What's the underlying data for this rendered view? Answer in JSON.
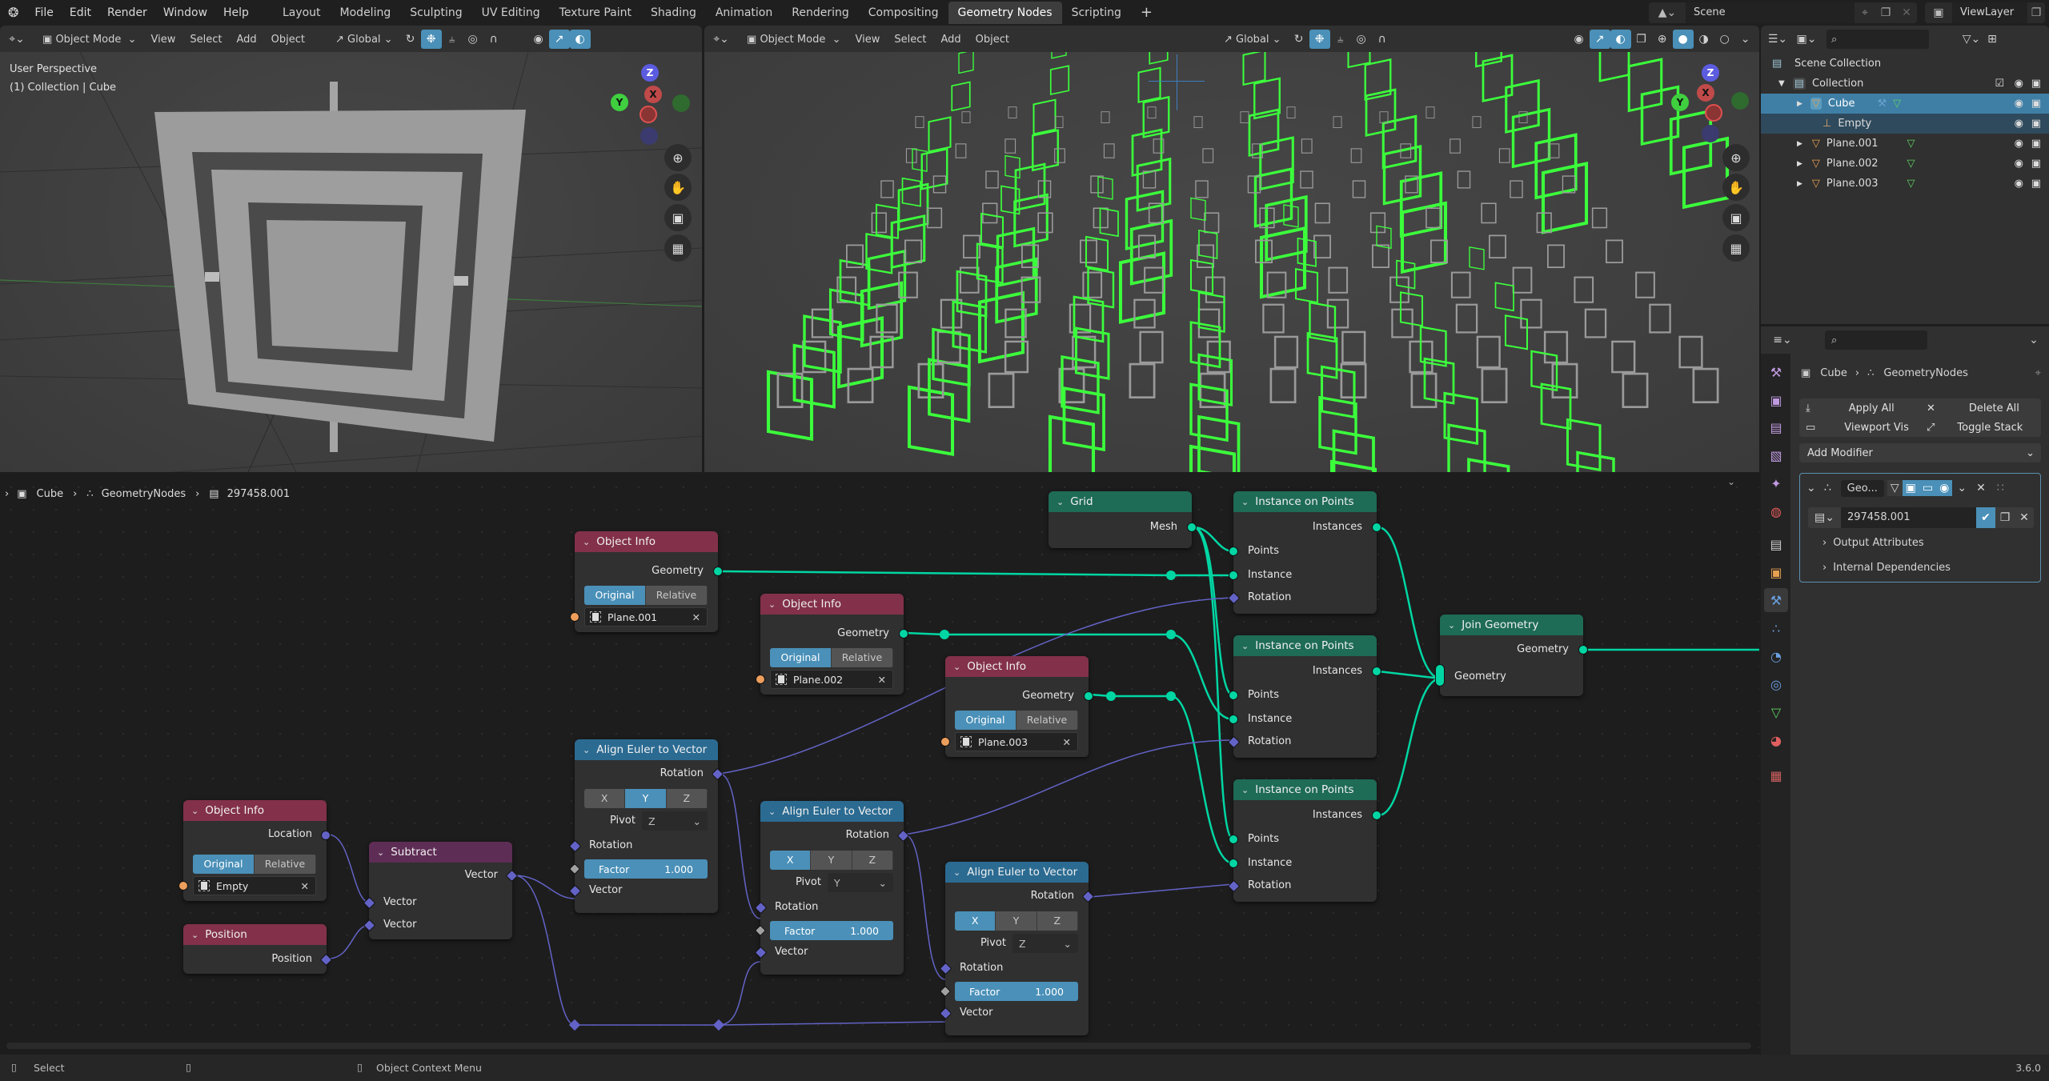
{
  "topbar": {
    "menus": [
      "File",
      "Edit",
      "Render",
      "Window",
      "Help"
    ],
    "workspaces": [
      "Layout",
      "Modeling",
      "Sculpting",
      "UV Editing",
      "Texture Paint",
      "Shading",
      "Animation",
      "Rendering",
      "Compositing",
      "Geometry Nodes",
      "Scripting"
    ],
    "active_workspace": "Geometry Nodes",
    "add_tab": "+",
    "scene": "Scene",
    "view_layer": "ViewLayer"
  },
  "viewport_left": {
    "mode": "Object Mode",
    "menus": [
      "View",
      "Select",
      "Add",
      "Object"
    ],
    "transform_orientation": "Global",
    "overlay_title": "User Perspective",
    "overlay_subtitle": "(1) Collection | Cube",
    "gizmo": {
      "z": "Z",
      "y": "Y",
      "x": "X"
    }
  },
  "viewport_right": {
    "mode": "Object Mode",
    "menus": [
      "View",
      "Select",
      "Add",
      "Object"
    ],
    "transform_orientation": "Global",
    "gizmo": {
      "z": "Z",
      "y": "Y",
      "x": "X"
    }
  },
  "outliner": {
    "search_placeholder": "",
    "rows": [
      {
        "name": "Scene Collection",
        "type": "scene-collection",
        "state": "normal"
      },
      {
        "name": "Collection",
        "type": "collection",
        "state": "normal"
      },
      {
        "name": "Cube",
        "type": "mesh",
        "state": "selected"
      },
      {
        "name": "Empty",
        "type": "empty",
        "state": "active"
      },
      {
        "name": "Plane.001",
        "type": "mesh",
        "state": "normal"
      },
      {
        "name": "Plane.002",
        "type": "mesh",
        "state": "normal"
      },
      {
        "name": "Plane.003",
        "type": "mesh",
        "state": "normal"
      }
    ]
  },
  "properties": {
    "breadcrumb": [
      "Cube",
      "GeometryNodes"
    ],
    "apply_all": "Apply All",
    "delete_all": "Delete All",
    "viewport_vis": "Viewport Vis",
    "toggle_stack": "Toggle Stack",
    "add_modifier": "Add Modifier",
    "modifier_name": "Geo...",
    "node_group": "297458.001",
    "output_attributes": "Output Attributes",
    "internal_dependencies": "Internal Dependencies"
  },
  "node_editor": {
    "breadcrumb": [
      "Cube",
      "GeometryNodes",
      "297458.001"
    ],
    "nodes": {
      "objinfo_plane001": {
        "title": "Object Info",
        "output": "Geometry",
        "seg": [
          "Original",
          "Relative"
        ],
        "object": "Plane.001"
      },
      "objinfo_plane002": {
        "title": "Object Info",
        "output": "Geometry",
        "seg": [
          "Original",
          "Relative"
        ],
        "object": "Plane.002"
      },
      "objinfo_plane003": {
        "title": "Object Info",
        "output": "Geometry",
        "seg": [
          "Original",
          "Relative"
        ],
        "object": "Plane.003"
      },
      "objinfo_empty": {
        "title": "Object Info",
        "output": "Location",
        "seg": [
          "Original",
          "Relative"
        ],
        "object": "Empty"
      },
      "position": {
        "title": "Position",
        "output": "Position"
      },
      "subtract": {
        "title": "Subtract",
        "output": "Vector",
        "inputs": [
          "Vector",
          "Vector"
        ]
      },
      "align1": {
        "title": "Align Euler to Vector",
        "output": "Rotation",
        "axes": [
          "X",
          "Y",
          "Z"
        ],
        "axis": "Y",
        "pivot_label": "Pivot",
        "pivot": "Z",
        "inputs": [
          "Rotation",
          "Vector"
        ],
        "factor_label": "Factor",
        "factor": "1.000"
      },
      "align2": {
        "title": "Align Euler to Vector",
        "output": "Rotation",
        "axes": [
          "X",
          "Y",
          "Z"
        ],
        "axis": "X",
        "pivot_label": "Pivot",
        "pivot": "Y",
        "inputs": [
          "Rotation",
          "Vector"
        ],
        "factor_label": "Factor",
        "factor": "1.000"
      },
      "align3": {
        "title": "Align Euler to Vector",
        "output": "Rotation",
        "axes": [
          "X",
          "Y",
          "Z"
        ],
        "axis": "X",
        "pivot_label": "Pivot",
        "pivot": "Z",
        "inputs": [
          "Rotation",
          "Vector"
        ],
        "factor_label": "Factor",
        "factor": "1.000"
      },
      "grid": {
        "title": "Grid",
        "output": "Mesh"
      },
      "iop1": {
        "title": "Instance on Points",
        "output": "Instances",
        "inputs": [
          "Points",
          "Instance",
          "Rotation"
        ]
      },
      "iop2": {
        "title": "Instance on Points",
        "output": "Instances",
        "inputs": [
          "Points",
          "Instance",
          "Rotation"
        ]
      },
      "iop3": {
        "title": "Instance on Points",
        "output": "Instances",
        "inputs": [
          "Points",
          "Instance",
          "Rotation"
        ]
      },
      "join": {
        "title": "Join Geometry",
        "output": "Geometry",
        "input": "Geometry"
      }
    }
  },
  "statusbar": {
    "select": "Select",
    "context_menu": "Object Context Menu",
    "version": "3.6.0"
  },
  "colors": {
    "accent": "#4a90b8",
    "geometry_socket": "#00d6a3",
    "vector_socket": "#6363c7",
    "object_socket": "#ed9e5c",
    "input_node_header": "#83314a",
    "geometry_node_header": "#1e6b56",
    "vector_node_header": "#2b6b92",
    "utility_node_header": "#5e2d55",
    "selection_outline": "#3cff3c"
  }
}
